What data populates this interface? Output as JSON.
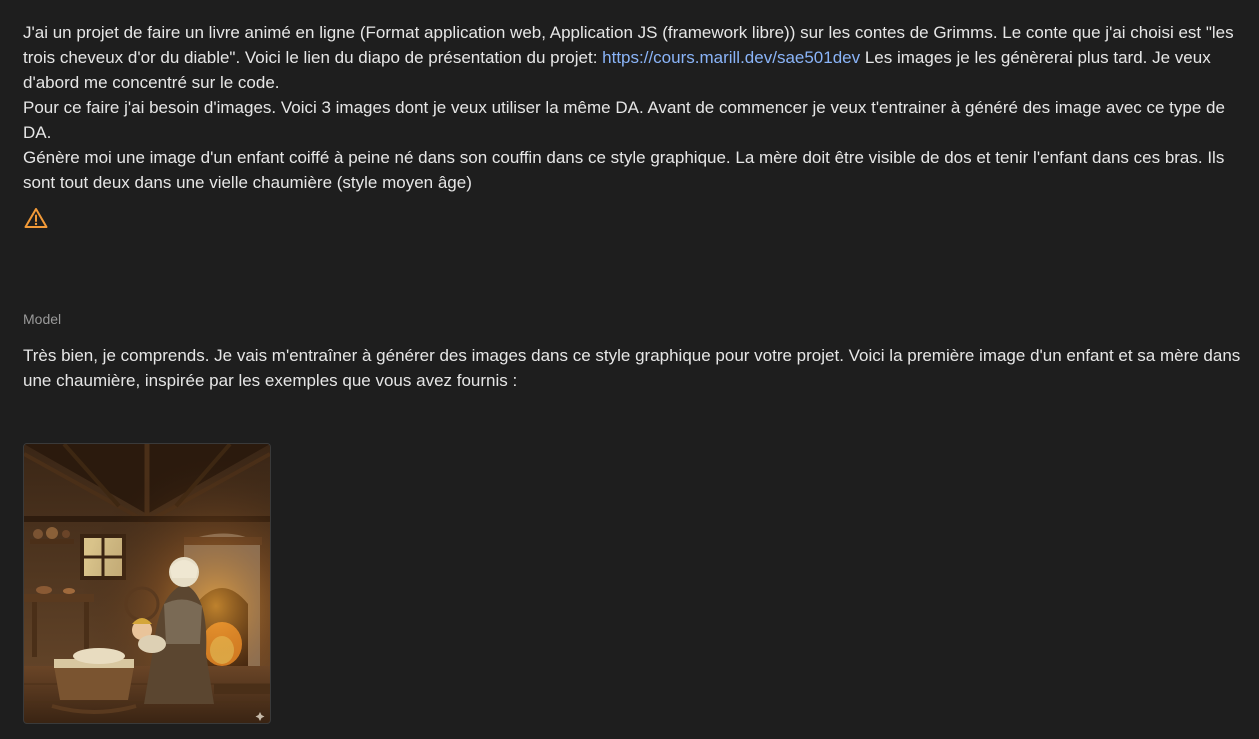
{
  "user_message": {
    "part1": "J'ai un projet de faire un livre animé en ligne (Format application web, Application JS (framework libre)) sur les contes de Grimms. Le conte que j'ai choisi est \"les trois cheveux d'or du diable\". Voici le lien du diapo de présentation du projet: ",
    "link_text": "https://cours.marill.dev/sae501dev",
    "part2": " Les images je les génèrerai plus tard. Je veux d'abord me concentré sur le code.",
    "line2": "Pour ce faire j'ai besoin d'images. Voici 3 images dont je veux utiliser la même DA. Avant de commencer je veux t'entrainer à généré des image avec ce type de DA.",
    "line3": "Génère moi une image d'un enfant coiffé à peine né dans son couffin dans ce style graphique. La mère doit être visible de dos et tenir l'enfant dans ces bras. Ils sont tout deux dans une vielle chaumière (style moyen âge)"
  },
  "warning_icon": "warning-triangle-icon",
  "model_label": "Model",
  "model_message": {
    "text": "Très bien, je comprends. Je vais m'entraîner à générer des images dans ce style graphique pour votre projet. Voici la première image d'un enfant et sa mère dans une chaumière, inspirée par les exemples que vous avez fournis :"
  },
  "colors": {
    "background": "#1e1e1e",
    "text": "#e6e6e6",
    "link": "#8ab4f8",
    "warning": "#f29a38",
    "label": "#9a9a9a"
  }
}
